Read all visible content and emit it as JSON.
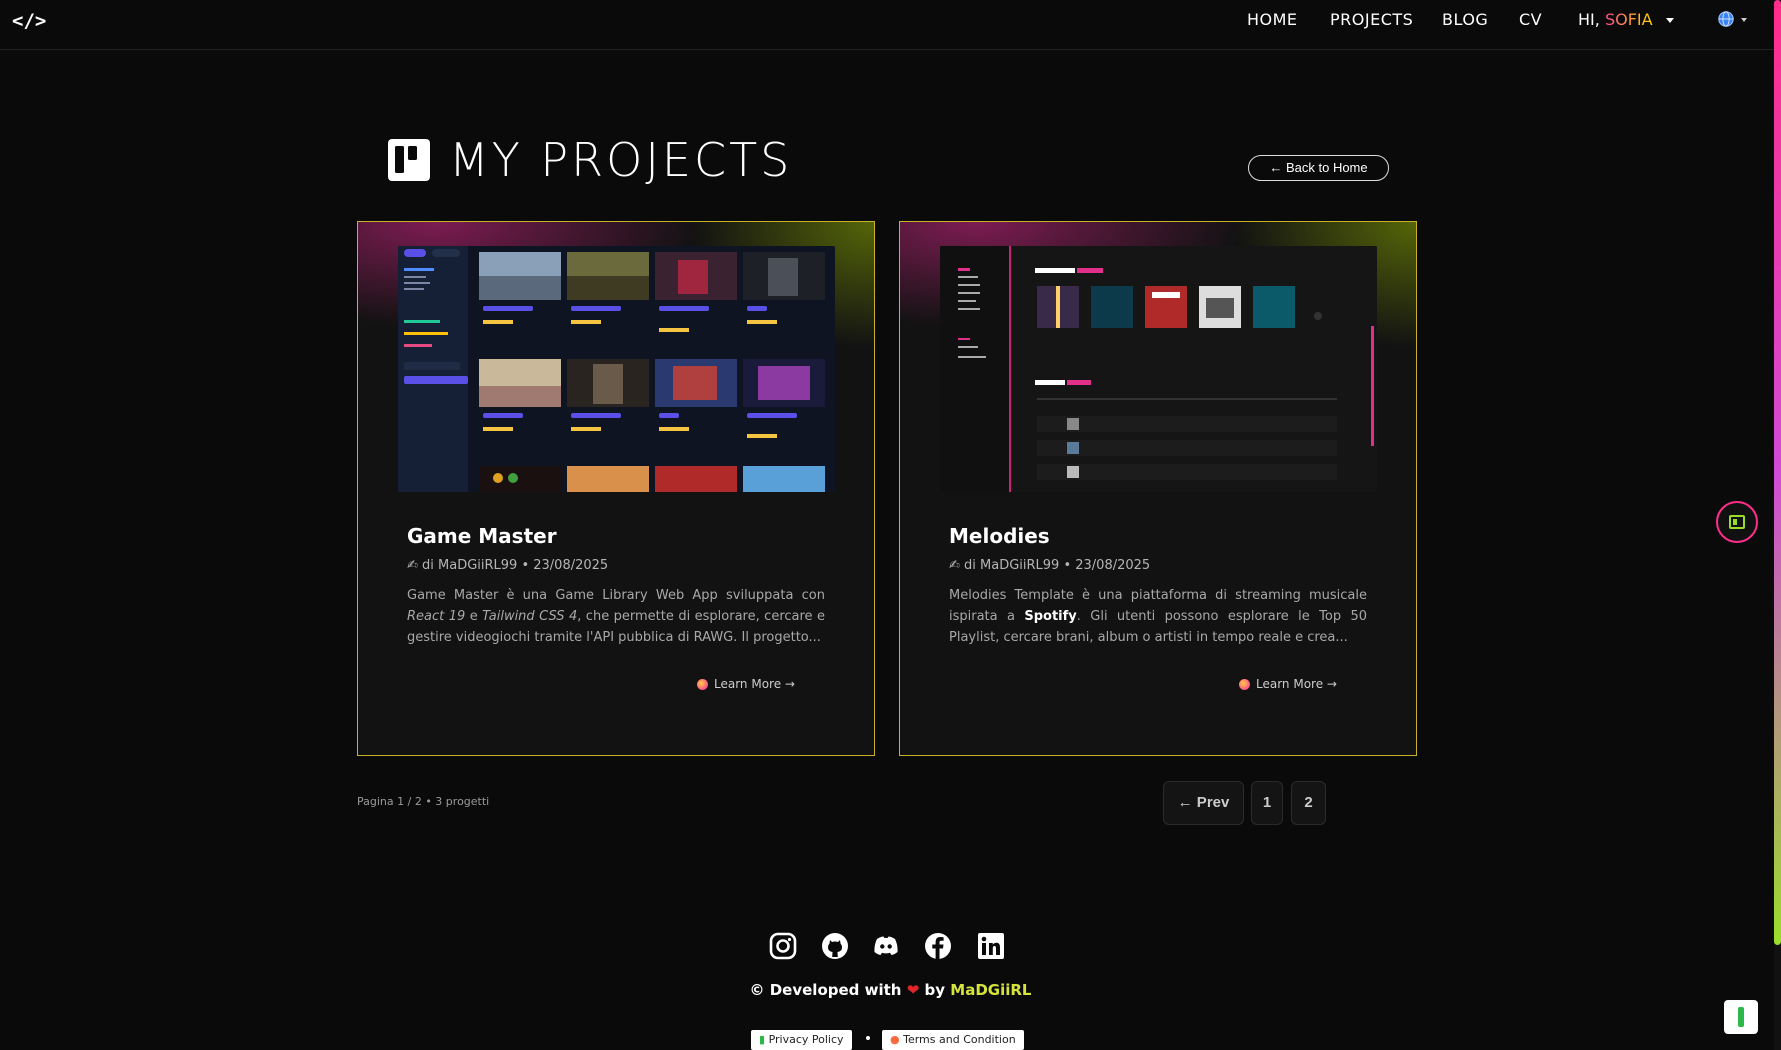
{
  "nav": {
    "logo": "</>",
    "links": [
      "HOME",
      "PROJECTS",
      "BLOG",
      "CV"
    ],
    "greeting": "HI,",
    "user_name": "SOFIA",
    "globe_icon": "globe-icon"
  },
  "header": {
    "title": "MY PROJECTS",
    "back_label": "← Back to Home"
  },
  "cards": [
    {
      "title": "Game Master",
      "meta": "✍ di MaDGiiRL99 • 23/08/2025",
      "desc_html": "Game Master è una Game Library Web App sviluppata con <em>React 19</em> e <em>Tailwind CSS 4</em>, che permette di esplorare, cercare e gestire videogiochi tramite l'API pubblica di RAWG. Il progetto...",
      "learn_label": "Learn More →"
    },
    {
      "title": "Melodies",
      "meta": "✍ di MaDGiiRL99 • 23/08/2025",
      "desc_html": "Melodies Template è una piattaforma di streaming musicale ispirata a <b>Spotify</b>. Gli utenti possono esplorare le Top 50 Playlist, cercare brani, album o artisti in tempo reale e crea...",
      "learn_label": "Learn More →"
    }
  ],
  "pagination": {
    "info": "Pagina 1 / 2 • 3 progetti",
    "prev_label": "← Prev",
    "pages": [
      "1",
      "2"
    ]
  },
  "footer": {
    "social_icons": [
      "instagram-icon",
      "github-icon",
      "discord-icon",
      "facebook-icon",
      "linkedin-icon"
    ],
    "credit_prefix": "© Developed with",
    "credit_by": "by",
    "brand": "MaDGiiRL",
    "privacy_label": "Privacy Policy",
    "terms_label": "Terms and Condition"
  },
  "colors": {
    "accent_pink": "#ff2d8b",
    "accent_lime": "#9ade2a",
    "card_border": "#c7b12a"
  }
}
